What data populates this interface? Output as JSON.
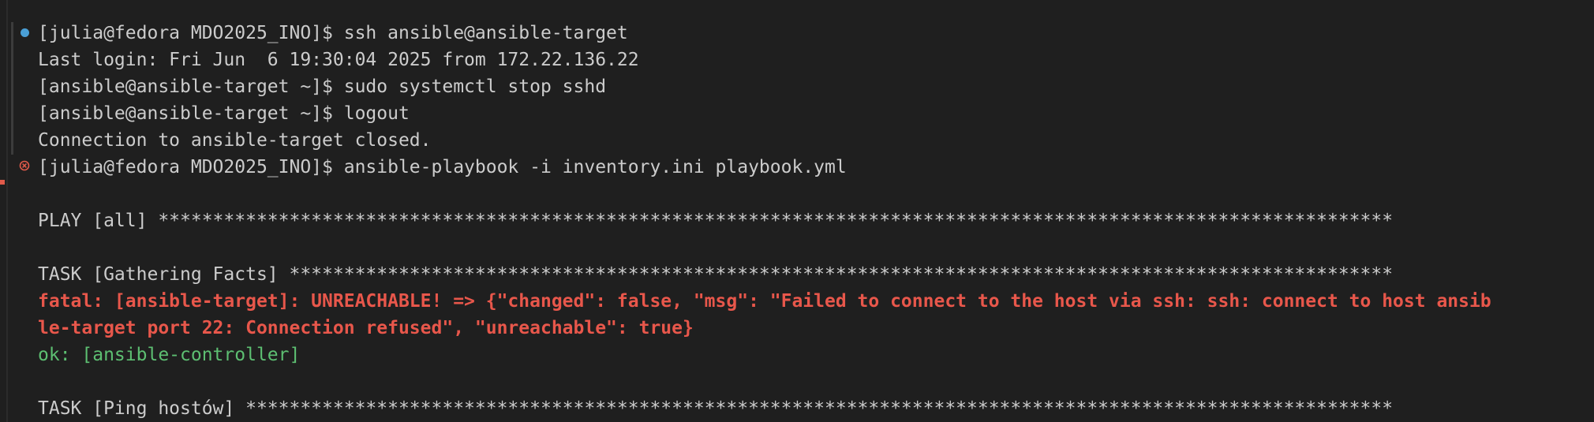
{
  "terminal": {
    "lines": [
      "[julia@fedora MDO2025_INO]$ ssh ansible@ansible-target",
      "Last login: Fri Jun  6 19:30:04 2025 from 172.22.136.22",
      "[ansible@ansible-target ~]$ sudo systemctl stop sshd",
      "[ansible@ansible-target ~]$ logout",
      "Connection to ansible-target closed.",
      "[julia@fedora MDO2025_INO]$ ansible-playbook -i inventory.ini playbook.yml",
      "",
      "PLAY [all] *****************************************************************************************************************",
      "",
      "TASK [Gathering Facts] *****************************************************************************************************",
      "fatal: [ansible-target]: UNREACHABLE! => {\"changed\": false, \"msg\": \"Failed to connect to the host via ssh: ssh: connect to host ansib",
      "le-target port 22: Connection refused\", \"unreachable\": true}",
      "ok: [ansible-controller]",
      "",
      "TASK [Ping hostów] *********************************************************************************************************"
    ],
    "decorations": {
      "success_icon": "filled-circle-icon",
      "error_icon": "circled-x-icon",
      "success_color": "#4a9fd6",
      "error_color": "#e05a4a"
    },
    "colors": {
      "background": "#1f1f1f",
      "text": "#cccccc",
      "error_text": "#e8574b",
      "ok_text": "#5dbf72"
    }
  }
}
